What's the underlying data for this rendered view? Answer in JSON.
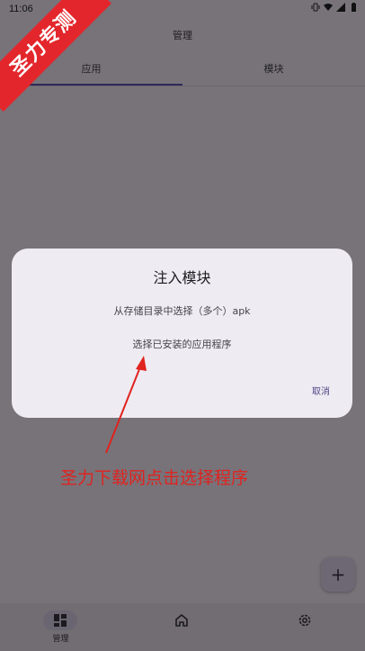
{
  "status_bar": {
    "time": "11:06",
    "icons": [
      "vibrate-icon",
      "wifi-icon",
      "signal-icon",
      "battery-icon"
    ]
  },
  "app": {
    "title": "管理",
    "tabs": [
      {
        "label": "应用",
        "selected": true
      },
      {
        "label": "模块",
        "selected": false
      }
    ],
    "fab_icon": "+",
    "bottom_nav": [
      {
        "label": "管理",
        "icon": "dashboard-icon",
        "selected": true
      },
      {
        "label": "",
        "icon": "home-icon",
        "selected": false
      },
      {
        "label": "",
        "icon": "settings-icon",
        "selected": false
      }
    ]
  },
  "dialog": {
    "title": "注入模块",
    "options": [
      "从存储目录中选择（多个）apk",
      "选择已安装的应用程序"
    ],
    "cancel_label": "取消"
  },
  "watermark": {
    "text": "圣力专测",
    "color": "#e3262b"
  },
  "annotation": {
    "text": "圣力下载网点击选择程序",
    "color": "#e0231f"
  },
  "colors": {
    "scrim_background": "#777379",
    "dialog_background": "#efebf3",
    "accent": "#4f4784"
  }
}
